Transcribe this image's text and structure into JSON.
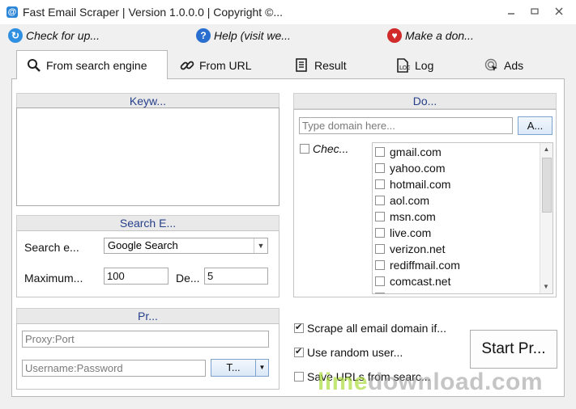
{
  "window": {
    "title": "Fast Email Scraper | Version 1.0.0.0 | Copyright ©...",
    "icon": "app-email-icon",
    "buttons": [
      "minimize-icon",
      "maximize-icon",
      "close-icon"
    ]
  },
  "toolbar": {
    "check_updates": "Check for up...",
    "help": "Help (visit we...",
    "donate": "Make a don..."
  },
  "tabs": [
    {
      "label": "From search engine",
      "icon": "magnifier-icon",
      "active": true
    },
    {
      "label": "From URL",
      "icon": "link-icon",
      "active": false
    },
    {
      "label": "Result",
      "icon": "document-list-icon",
      "active": false
    },
    {
      "label": "Log",
      "icon": "log-page-icon",
      "active": false
    },
    {
      "label": "Ads",
      "icon": "ads-cursor-icon",
      "active": false
    }
  ],
  "keywords": {
    "header": "Keyw...",
    "value": ""
  },
  "search_engine": {
    "header": "Search E...",
    "engine_label": "Search e...",
    "engine_value": "Google Search",
    "maximum_label": "Maximum...",
    "maximum_value": "100",
    "delay_label": "De...",
    "delay_value": "5"
  },
  "proxy": {
    "header": "Pr...",
    "proxy_placeholder": "Proxy:Port",
    "auth_placeholder": "Username:Password",
    "test_button": "T..."
  },
  "domain": {
    "header": "Do...",
    "input_placeholder": "Type domain here...",
    "add_button": "A...",
    "check_all_label": "Chec...",
    "items": [
      "gmail.com",
      "yahoo.com",
      "hotmail.com",
      "aol.com",
      "msn.com",
      "live.com",
      "verizon.net",
      "rediffmail.com",
      "comcast.net",
      "hotmail.co.uk"
    ]
  },
  "options": {
    "scrape_all": {
      "label": "Scrape all email domain if...",
      "checked": true
    },
    "random_user": {
      "label": "Use random user...",
      "checked": true
    },
    "save_urls": {
      "label": "Save URLs from searc...",
      "checked": false
    }
  },
  "start_button": "Start Pr...",
  "watermark": {
    "part1": "lime",
    "part2": "download.com"
  }
}
